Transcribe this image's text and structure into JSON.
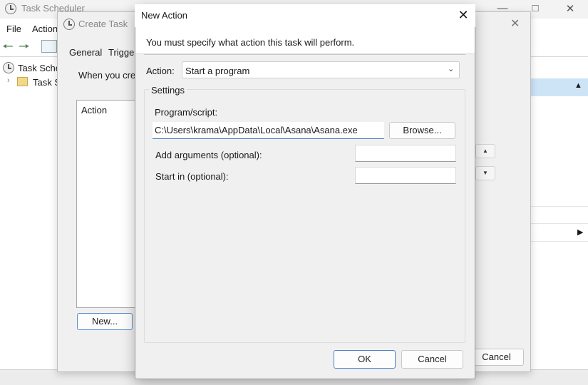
{
  "task_scheduler": {
    "title": "Task Scheduler",
    "menu": {
      "file": "File",
      "action": "Action"
    },
    "tree": {
      "root": "Task Sche",
      "child": "Task S"
    }
  },
  "create_task": {
    "title": "Create Task",
    "tabs": {
      "general": "General",
      "triggers": "Trigge"
    },
    "description": "When you cre",
    "action_column_header": "Action",
    "new_button": "New...",
    "cancel_button": "Cancel"
  },
  "new_action": {
    "title": "New Action",
    "header_text": "You must specify what action this task will perform.",
    "action_label": "Action:",
    "action_value": "Start a program",
    "settings_label": "Settings",
    "program_label": "Program/script:",
    "program_value": "C:\\Users\\krama\\AppData\\Local\\Asana\\Asana.exe",
    "browse_button": "Browse...",
    "args_label": "Add arguments (optional):",
    "args_value": "",
    "startin_label": "Start in (optional):",
    "startin_value": "",
    "ok_button": "OK",
    "cancel_button": "Cancel"
  },
  "icons": {
    "close": "close-icon",
    "chevron": "chevron-down-icon",
    "clock": "clock-icon"
  },
  "colors": {
    "accent": "#4d7fc4",
    "selected_header": "#cde4f7"
  }
}
